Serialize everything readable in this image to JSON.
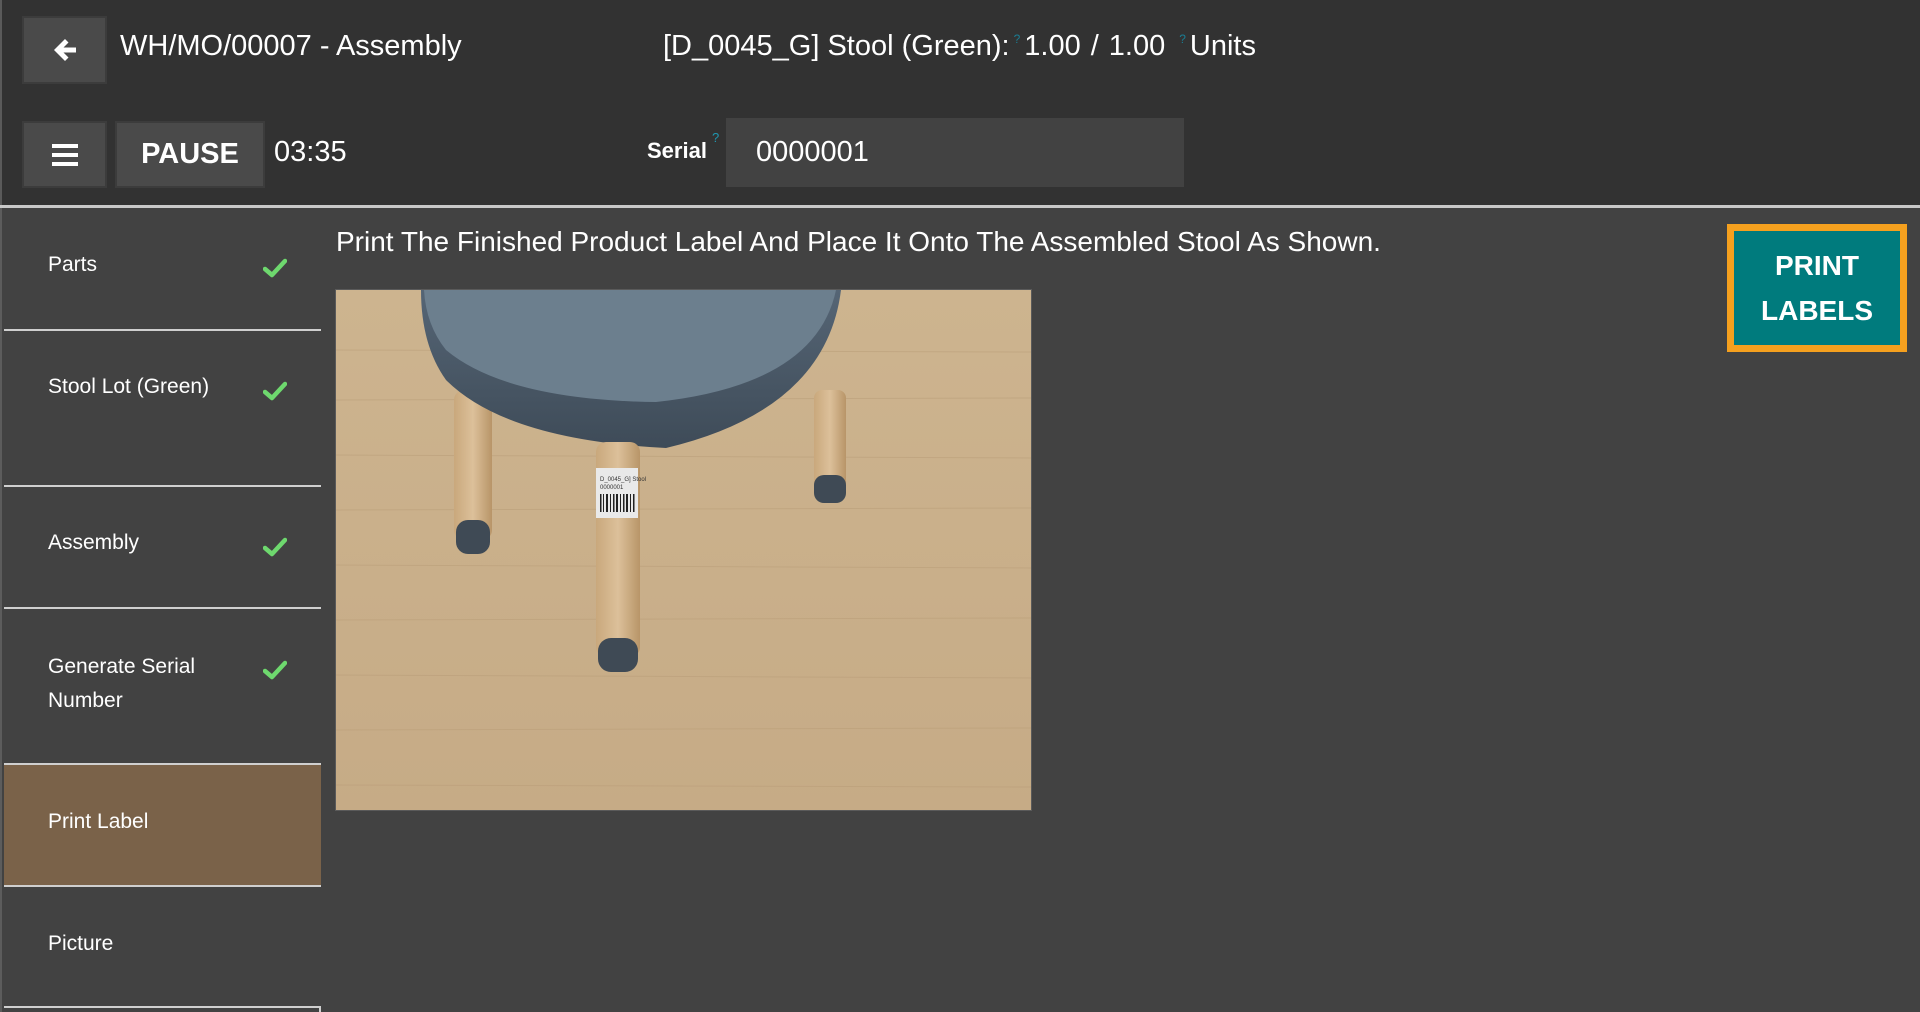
{
  "header": {
    "title": "WH/MO/00007 - Assembly",
    "back_icon": "arrow-left-icon",
    "menu_icon": "hamburger-menu-icon",
    "pause_label": "PAUSE",
    "timer": "03:35",
    "product": {
      "name": "[D_0045_G] Stool (Green):",
      "qty_done": "1.00",
      "separator": "/",
      "qty_total": "1.00",
      "uom": "Units",
      "help_mark": "?"
    },
    "serial": {
      "label": "Serial",
      "help_mark": "?",
      "value": "0000001"
    }
  },
  "sidebar": {
    "steps": [
      {
        "label": "Parts",
        "done": true,
        "active": false
      },
      {
        "label": "Stool Lot (Green)",
        "done": true,
        "active": false
      },
      {
        "label": "Assembly",
        "done": true,
        "active": false
      },
      {
        "label": "Generate Serial Number",
        "done": true,
        "active": false
      },
      {
        "label": "Print Label",
        "done": false,
        "active": true
      },
      {
        "label": "Picture",
        "done": false,
        "active": false
      }
    ]
  },
  "main": {
    "instruction": "Print The Finished Product Label And Place It Onto The Assembled Stool As Shown.",
    "image_alt": "Assembled green stool with serial label on leg",
    "label_sticker": {
      "line1": "D_0045_G] Stool",
      "line2": "0000001"
    },
    "print_button": {
      "line1": "PRINT",
      "line2": "LABELS"
    }
  },
  "colors": {
    "background": "#323232",
    "panel": "#424242",
    "active_step": "#7a6249",
    "check": "#6ed86e",
    "print_button": "#007b7d",
    "print_button_border": "#f5a01e",
    "help_mark": "#1a7d93"
  }
}
